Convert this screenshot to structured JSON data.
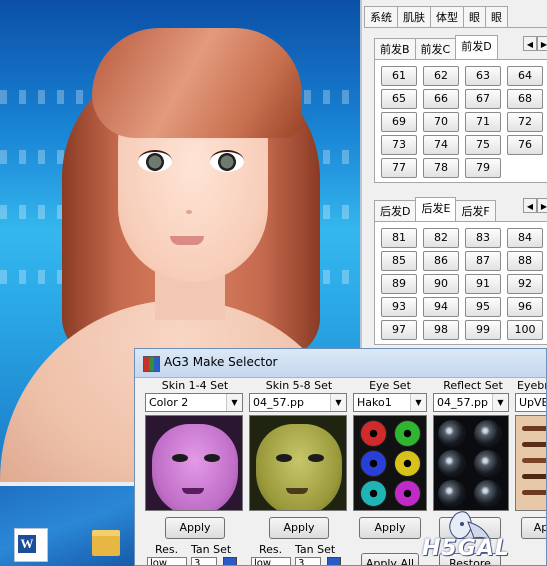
{
  "panel": {
    "top_tabs": [
      "系统",
      "肌肤",
      "体型",
      "眼",
      "眼"
    ],
    "front_hair": {
      "tabs": [
        "前发B",
        "前发C",
        "前发D"
      ],
      "active_tab": "前发D",
      "buttons": [
        "61",
        "62",
        "63",
        "64",
        "65",
        "66",
        "67",
        "68",
        "69",
        "70",
        "71",
        "72",
        "73",
        "74",
        "75",
        "76",
        "77",
        "78",
        "79"
      ]
    },
    "back_hair": {
      "tabs": [
        "后发D",
        "后发E",
        "后发F"
      ],
      "active_tab": "后发E",
      "buttons": [
        "81",
        "82",
        "83",
        "84",
        "85",
        "86",
        "87",
        "88",
        "89",
        "90",
        "91",
        "92",
        "93",
        "94",
        "95",
        "96",
        "97",
        "98",
        "99",
        "100"
      ]
    }
  },
  "dialog": {
    "title": "AG3 Make Selector",
    "columns": [
      {
        "label": "Skin 1-4 Set",
        "value": "Color 2",
        "apply": "Apply"
      },
      {
        "label": "Skin 5-8 Set",
        "value": "04_57.pp",
        "apply": "Apply"
      },
      {
        "label": "Eye Set",
        "value": "Hako1",
        "apply": "Apply"
      },
      {
        "label": "Reflect Set",
        "value": "04_57.pp",
        "apply": "Apply"
      },
      {
        "label": "Eyebro",
        "value": "UpVBro",
        "apply": "Ap"
      }
    ],
    "res_label_1": "Res.",
    "tan_label_1": "Tan Set",
    "res_value_1": "low",
    "tan_value_1": "3",
    "res_label_2": "Res.",
    "tan_label_2": "Tan Set",
    "res_value_2": "low",
    "tan_value_2": "3",
    "apply_all": "Apply All",
    "restore": "Restore",
    "eye_colors": [
      "#d12a2a",
      "#2fb52f",
      "#2a3fd6",
      "#d6c21a",
      "#1fb5b5",
      "#c02ac8"
    ],
    "skin_colors": {
      "set1": "#c06ec8",
      "set2": "#9a9a3c"
    }
  },
  "watermark": {
    "text": "H5GAL"
  }
}
